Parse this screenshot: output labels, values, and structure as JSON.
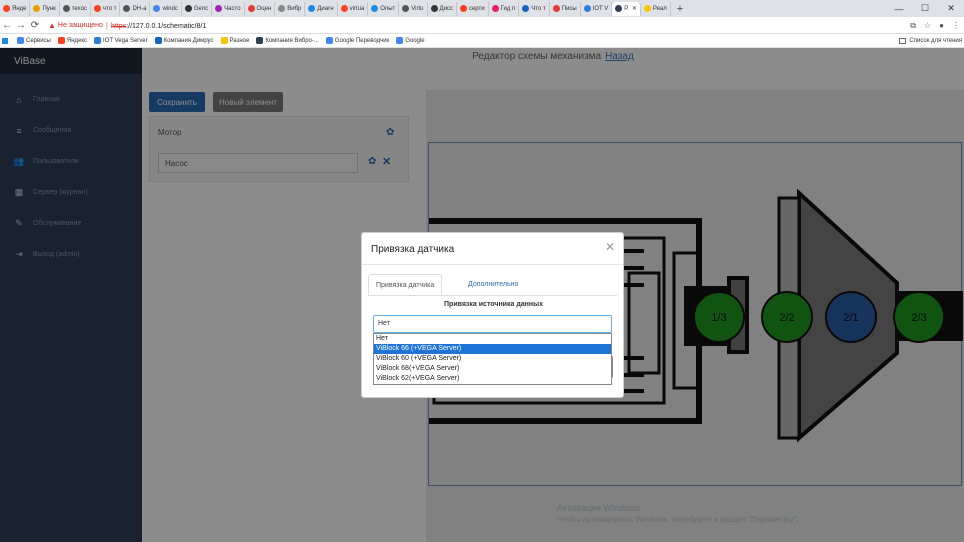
{
  "browser": {
    "tabs": [
      {
        "label": "Янде",
        "color": "#fc3f1d"
      },
      {
        "label": "Пунк",
        "color": "#e8a000"
      },
      {
        "label": "техос",
        "color": "#555555"
      },
      {
        "label": "что т",
        "color": "#fc3f1d"
      },
      {
        "label": "DH-a",
        "color": "#555555"
      },
      {
        "label": "windc",
        "color": "#4285f4"
      },
      {
        "label": "Genc",
        "color": "#333333"
      },
      {
        "label": "Часто",
        "color": "#9c27b0"
      },
      {
        "label": "Оцен",
        "color": "#e53935"
      },
      {
        "label": "Вибр",
        "color": "#888888"
      },
      {
        "label": "Диагн",
        "color": "#1e88e5"
      },
      {
        "label": "virtua",
        "color": "#fc3f1d"
      },
      {
        "label": "Опыт",
        "color": "#1e88e5"
      },
      {
        "label": "Virtu",
        "color": "#555555"
      },
      {
        "label": "Дисс",
        "color": "#333333"
      },
      {
        "label": "серти",
        "color": "#fc3f1d"
      },
      {
        "label": "Гид п",
        "color": "#e91e63"
      },
      {
        "label": "Что т",
        "color": "#1565c0"
      },
      {
        "label": "Писы",
        "color": "#e53935"
      },
      {
        "label": "IOT V",
        "color": "#2e7dd7"
      },
      {
        "label": "Р.",
        "color": "#2e3e55",
        "active": true
      },
      {
        "label": "Реал",
        "color": "#f6c400"
      }
    ],
    "window_controls": {
      "min": "—",
      "max": "☐",
      "close": "✕"
    },
    "address": {
      "warning": "Не защищено",
      "protocol": "https",
      "path": "://127.0.0.1/schematic/8/1"
    },
    "bookmarks": [
      {
        "label": "Сервисы",
        "color": "#4285f4"
      },
      {
        "label": "Яндекс",
        "color": "#fc3f1d"
      },
      {
        "label": "IOT Vega Server",
        "color": "#2e7dd7"
      },
      {
        "label": "Компания Димрус",
        "color": "#1565c0"
      },
      {
        "label": "Разное",
        "color": "#f6c400"
      },
      {
        "label": "Компания Вибро-...",
        "color": "#2e3e55"
      },
      {
        "label": "Google Переводчик",
        "color": "#4285f4"
      },
      {
        "label": "Google",
        "color": "#4285f4"
      }
    ],
    "reading_list": "Список для чтения"
  },
  "sidebar": {
    "brand": "ViBase",
    "items": [
      {
        "label": "Главная",
        "icon": "home-icon"
      },
      {
        "label": "Сообщения",
        "icon": "list-icon"
      },
      {
        "label": "Пользователи",
        "icon": "users-icon"
      },
      {
        "label": "Сервер (журнал)",
        "icon": "server-icon"
      },
      {
        "label": "Обслуживание",
        "icon": "wrench-icon"
      },
      {
        "label": "Выход (admin)",
        "icon": "logout-icon"
      }
    ]
  },
  "page": {
    "title": "Редактор схемы механизма",
    "back_link": "Назад",
    "save_button": "Сохранить",
    "new_element_button": "Новый элемент",
    "elements": [
      {
        "name": "Мотор"
      },
      {
        "name": "Насос"
      }
    ]
  },
  "scheme": {
    "sensors": [
      {
        "label": "1/3",
        "color": "#1f9a1f"
      },
      {
        "label": "2/2",
        "color": "#1f9a1f"
      },
      {
        "label": "2/1",
        "color": "#2b5fa8"
      },
      {
        "label": "2/3",
        "color": "#1f9a1f"
      }
    ]
  },
  "watermark": {
    "line1": "Активация Windows",
    "line2": "Чтобы активировать Windows, перейдите в раздел \"Параметры\"."
  },
  "modal": {
    "title": "Привязка датчика",
    "tabs": [
      "Привязка датчика",
      "Дополнительно"
    ],
    "active_tab": 0,
    "source_heading": "Привязка источника данных",
    "selected_value": "Нет",
    "options": [
      "Нет",
      "ViBlock 66 (+VEGA Server)",
      "ViBlock 60 (+VEGA Server)",
      "ViBlock 68(+VEGA Server)",
      "ViBlock 62(+VEGA Server)"
    ],
    "highlighted_option": 1
  }
}
